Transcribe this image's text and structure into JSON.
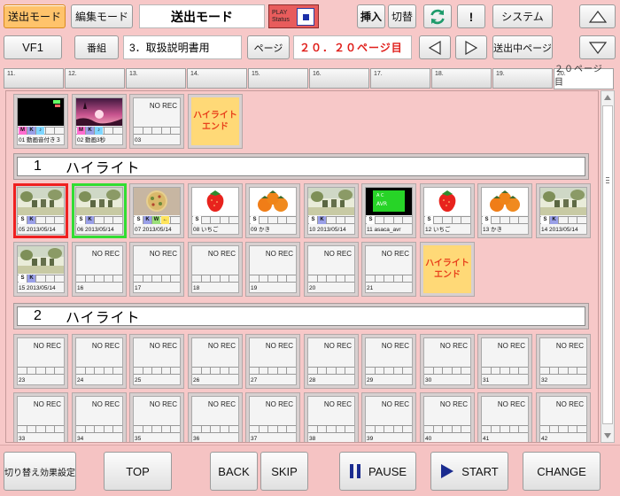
{
  "toolbar": {
    "send_mode_btn": "送出モード",
    "edit_mode_btn": "編集モード",
    "mode_title": "送出モード",
    "play_status_line1": "PLAY",
    "play_status_line2": "Status",
    "insert_label": "挿入",
    "switch_label": "切替",
    "exclaim_label": "!",
    "system_label": "システム"
  },
  "row2": {
    "vf_label": "VF1",
    "program_label": "番組",
    "program_value": "3．取扱説明書用",
    "page_label": "ページ",
    "page_value": "２０．２０ページ目",
    "sending_page_label": "送出中ページ"
  },
  "page_tabs": [
    {
      "num": "11.",
      "sub": ""
    },
    {
      "num": "12.",
      "sub": ""
    },
    {
      "num": "13.",
      "sub": ""
    },
    {
      "num": "14.",
      "sub": ""
    },
    {
      "num": "15.",
      "sub": ""
    },
    {
      "num": "16.",
      "sub": ""
    },
    {
      "num": "17.",
      "sub": ""
    },
    {
      "num": "18.",
      "sub": ""
    },
    {
      "num": "19.",
      "sub": ""
    },
    {
      "num": "20.",
      "sub": "２０ページ目"
    }
  ],
  "no_rec": "NO REC",
  "highlight_end": "ハイライト\nエンド",
  "top_cells": [
    {
      "cap": "01  動画音付き３",
      "badges": [
        "M",
        "K",
        "♪"
      ]
    },
    {
      "cap": "02  動画3秒",
      "badges": [
        "M",
        "K",
        "♪"
      ]
    },
    {
      "cap": "03"
    }
  ],
  "sections": [
    {
      "num": "1",
      "title": "ハイライト"
    },
    {
      "num": "2",
      "title": "ハイライト"
    }
  ],
  "sec1_row1": [
    {
      "cap": "05  2013/05/14",
      "badges": [
        "S",
        "K"
      ]
    },
    {
      "cap": "06  2013/05/14",
      "badges": [
        "S",
        "K"
      ]
    },
    {
      "cap": "07  2013/05/14",
      "badges": [
        "S",
        "K",
        "W",
        "←"
      ]
    },
    {
      "cap": "08  いちご",
      "badges": [
        "S"
      ]
    },
    {
      "cap": "09  かき",
      "badges": [
        "S"
      ]
    },
    {
      "cap": "10  2013/05/14",
      "badges": [
        "S",
        "K"
      ]
    },
    {
      "cap": "11  asaca_avr",
      "badges": [
        "S"
      ]
    },
    {
      "cap": "12  いちご",
      "badges": [
        "S"
      ]
    },
    {
      "cap": "13  かき",
      "badges": [
        "S"
      ]
    },
    {
      "cap": "14  2013/05/14",
      "badges": [
        "S",
        "K"
      ]
    }
  ],
  "sec1_row2": [
    {
      "cap": "15  2013/05/14",
      "badges": [
        "S",
        "K"
      ]
    },
    {
      "cap": "16"
    },
    {
      "cap": "17"
    },
    {
      "cap": "18"
    },
    {
      "cap": "19"
    },
    {
      "cap": "20"
    },
    {
      "cap": "21"
    }
  ],
  "sec2_row1": [
    "23",
    "24",
    "25",
    "26",
    "27",
    "28",
    "29",
    "30",
    "31",
    "32"
  ],
  "sec2_row2": [
    "33",
    "34",
    "35",
    "36",
    "37",
    "38",
    "39",
    "40",
    "41",
    "42"
  ],
  "bottom": {
    "effect_label": "切り替え効果設定",
    "top_label": "TOP",
    "back_label": "BACK",
    "skip_label": "SKIP",
    "pause_label": "PAUSE",
    "start_label": "START",
    "change_label": "CHANGE"
  },
  "colors": {
    "background": "#f7c8c8",
    "accent_orange": "#ffc36b",
    "play_red": "#e85c5c",
    "highlight_yellow": "#ffd977",
    "selected_red": "#ef2020",
    "selected_green": "#33dd33"
  }
}
